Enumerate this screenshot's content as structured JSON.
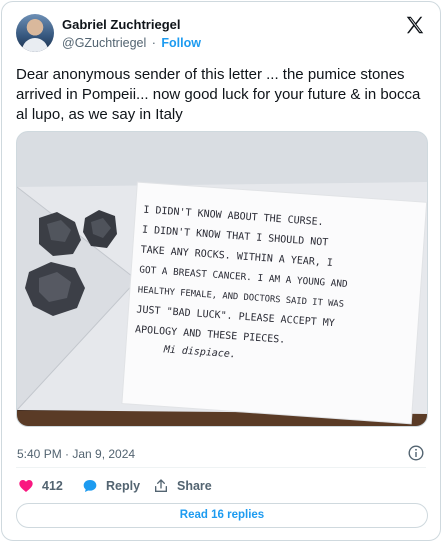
{
  "author": {
    "name": "Gabriel Zuchtriegel",
    "handle": "@GZuchtriegel",
    "separator": "·",
    "follow_label": "Follow"
  },
  "tweet": {
    "text": "Dear anonymous sender of this letter ... the pumice stones arrived in Pompeii... now good luck for your future & in bocca al lupo, as we say in Italy",
    "timestamp": "5:40 PM · Jan 9, 2024"
  },
  "letter": {
    "lines": [
      "I DIDN'T KNOW ABOUT THE CURSE.",
      "I DIDN'T KNOW THAT I SHOULD NOT",
      "TAKE ANY ROCKS. WITHIN A YEAR, I",
      "GOT A BREAST CANCER. I AM A YOUNG AND",
      "HEALTHY FEMALE, AND DOCTORS SAID IT WAS",
      "JUST \"BAD LUCK\". PLEASE ACCEPT MY",
      "APOLOGY AND THESE PIECES.",
      "Mi dispiace."
    ]
  },
  "actions": {
    "likes_count": "412",
    "reply_label": "Reply",
    "share_label": "Share"
  },
  "replies_button": "Read 16 replies",
  "icons": {
    "like": "heart-icon",
    "reply": "speech-bubble-icon",
    "share": "share-arrow-icon",
    "info": "info-icon",
    "brand": "x-logo-icon"
  },
  "colors": {
    "accent": "#1d9bf0",
    "like": "#f91880",
    "text": "#0f1419",
    "muted": "#536471",
    "border": "#cfd9de"
  }
}
